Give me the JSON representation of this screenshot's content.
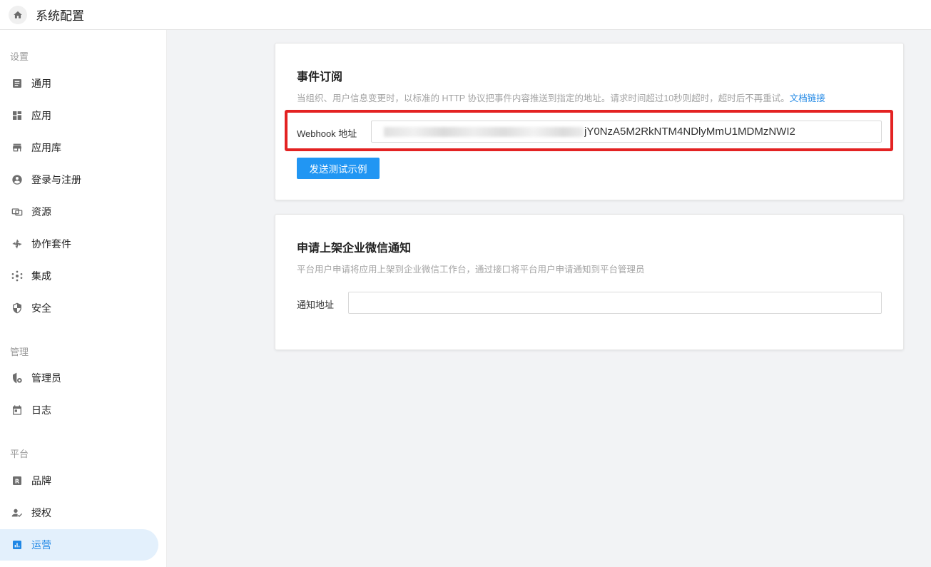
{
  "topbar": {
    "title": "系统配置",
    "home_icon": "home-icon"
  },
  "sidebar": {
    "sections": [
      {
        "label": "设置"
      },
      {
        "label": "管理"
      },
      {
        "label": "平台"
      }
    ],
    "items": [
      {
        "label": "通用",
        "icon": "document-icon"
      },
      {
        "label": "应用",
        "icon": "apps-grid-icon"
      },
      {
        "label": "应用库",
        "icon": "store-icon"
      },
      {
        "label": "登录与注册",
        "icon": "user-circle-icon"
      },
      {
        "label": "资源",
        "icon": "resource-icon"
      },
      {
        "label": "协作套件",
        "icon": "collaboration-icon"
      },
      {
        "label": "集成",
        "icon": "integration-icon"
      },
      {
        "label": "安全",
        "icon": "shield-icon"
      },
      {
        "label": "管理员",
        "icon": "admin-shield-icon"
      },
      {
        "label": "日志",
        "icon": "calendar-icon"
      },
      {
        "label": "品牌",
        "icon": "brand-r-icon"
      },
      {
        "label": "授权",
        "icon": "user-check-icon"
      },
      {
        "label": "运营",
        "icon": "bar-chart-icon",
        "active": true
      }
    ]
  },
  "event_card": {
    "title": "事件订阅",
    "desc": "当组织、用户信息变更时，以标准的 HTTP 协议把事件内容推送到指定的地址。请求时间超过10秒则超时，超时后不再重试。",
    "doc_link": "文档链接",
    "webhook_label": "Webhook 地址",
    "webhook_value": "jY0NzA5M2RkNTM4NDlyMmU1MDMzNWI2",
    "send_button": "发送测试示例"
  },
  "wecom_card": {
    "title": "申请上架企业微信通知",
    "desc": "平台用户申请将应用上架到企业微信工作台，通过接口将平台用户申请通知到平台管理员",
    "notify_label": "通知地址",
    "notify_value": ""
  },
  "colors": {
    "accent": "#2196f3",
    "active_bg": "#e3f0fc",
    "highlight_border": "#e32222"
  }
}
